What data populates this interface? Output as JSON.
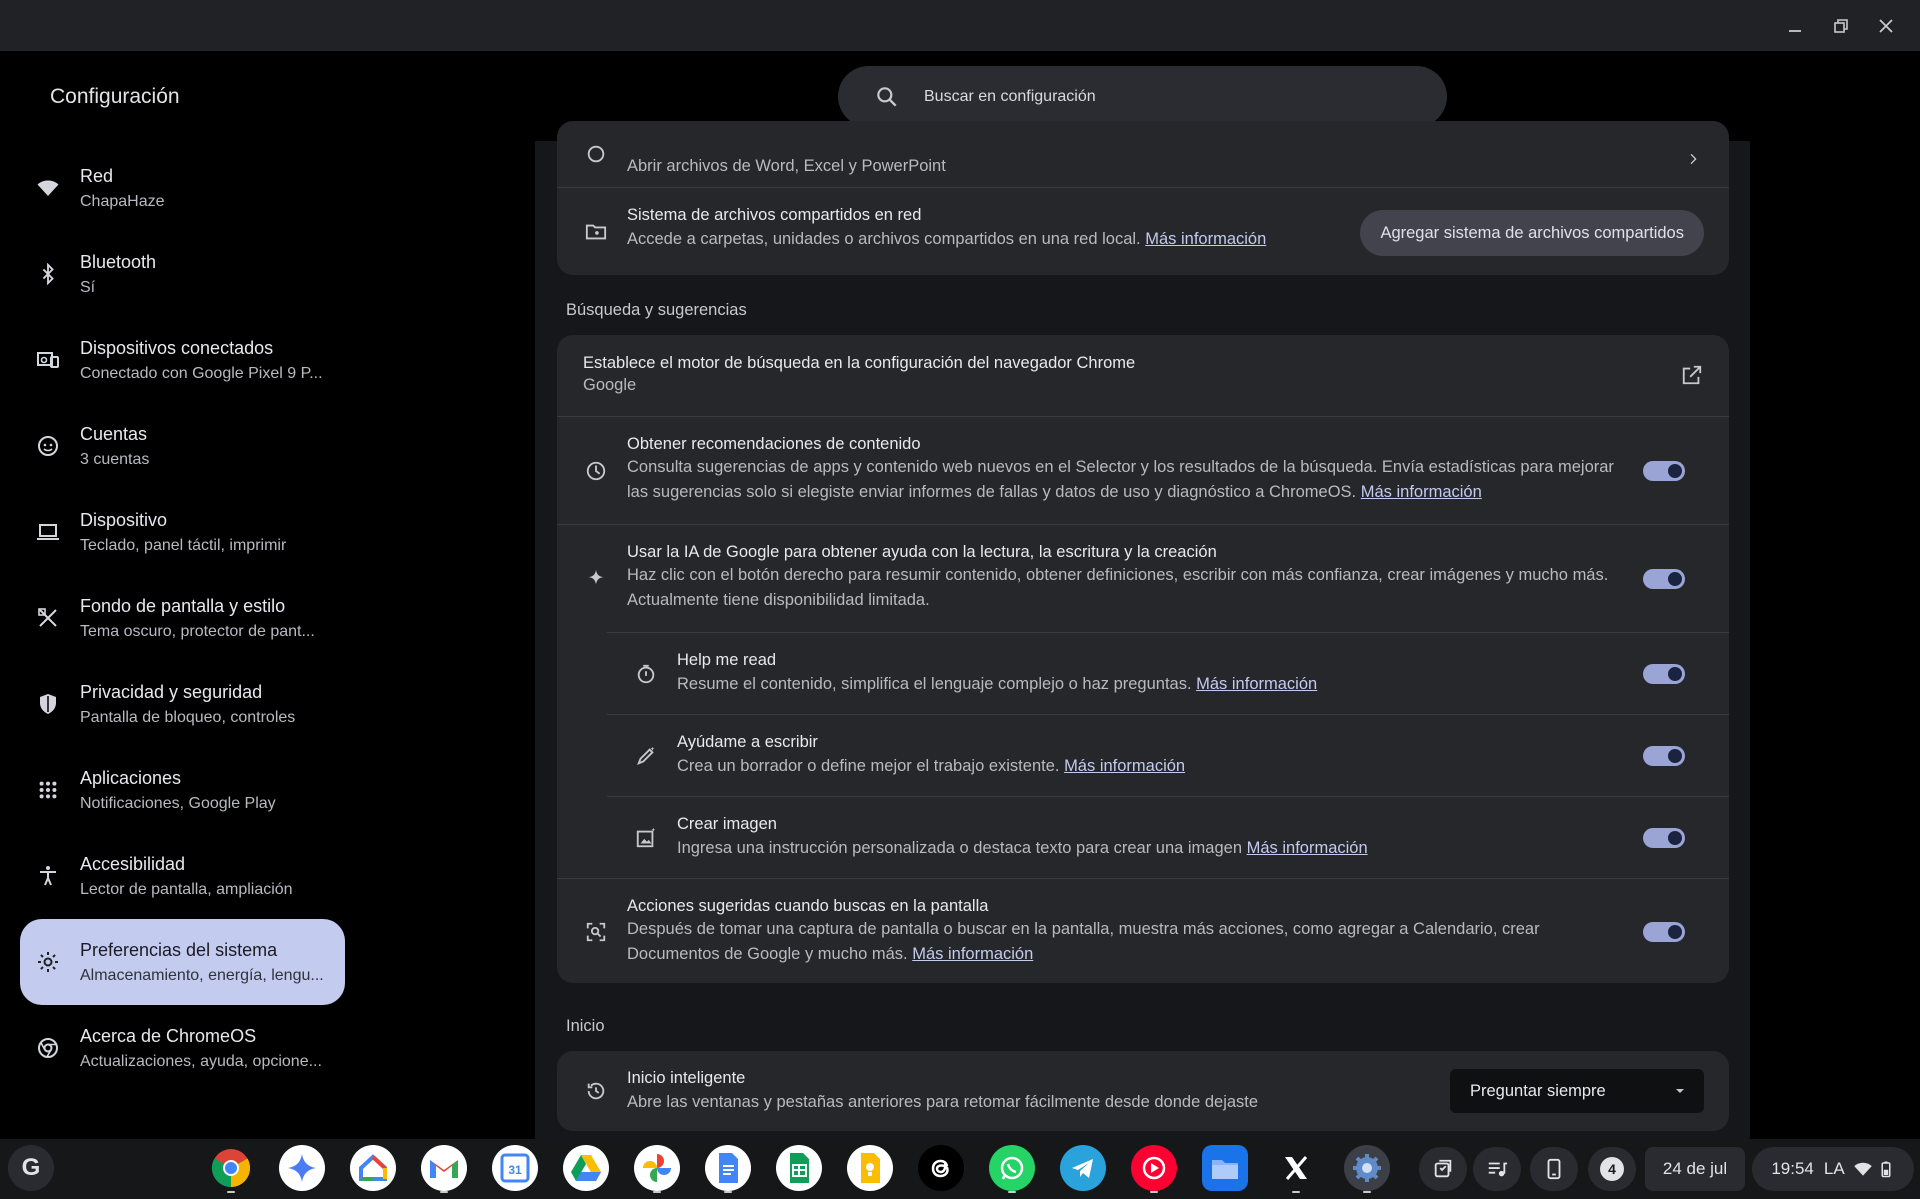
{
  "window": {
    "minimize": "minimize-icon",
    "restore": "restore-icon",
    "close": "close-icon"
  },
  "app": {
    "title": "Configuración"
  },
  "search": {
    "placeholder": "Buscar en configuración"
  },
  "sidebar": {
    "items": [
      {
        "title": "Red",
        "sub": "ChapaHaze",
        "icon": "wifi-icon"
      },
      {
        "title": "Bluetooth",
        "sub": "Sí",
        "icon": "bluetooth-icon"
      },
      {
        "title": "Dispositivos conectados",
        "sub": "Conectado con Google Pixel 9 P...",
        "icon": "devices-icon"
      },
      {
        "title": "Cuentas",
        "sub": "3 cuentas",
        "icon": "account-icon"
      },
      {
        "title": "Dispositivo",
        "sub": "Teclado, panel táctil, imprimir",
        "icon": "laptop-icon"
      },
      {
        "title": "Fondo de pantalla y estilo",
        "sub": "Tema oscuro, protector de pant...",
        "icon": "palette-icon"
      },
      {
        "title": "Privacidad y seguridad",
        "sub": "Pantalla de bloqueo, controles",
        "icon": "shield-icon"
      },
      {
        "title": "Aplicaciones",
        "sub": "Notificaciones, Google Play",
        "icon": "apps-grid-icon"
      },
      {
        "title": "Accesibilidad",
        "sub": "Lector de pantalla, ampliación",
        "icon": "accessibility-icon"
      },
      {
        "title": "Preferencias del sistema",
        "sub": "Almacenamiento, energía, lengu...",
        "icon": "gear-icon",
        "active": true
      },
      {
        "title": "Acerca de ChromeOS",
        "sub": "Actualizaciones, ayuda, opcione...",
        "icon": "chrome-icon"
      }
    ]
  },
  "main": {
    "files_card": {
      "office_desc": "Abrir archivos de Word, Excel y PowerPoint",
      "smb_title": "Sistema de archivos compartidos en red",
      "smb_desc": "Accede a carpetas, unidades o archivos compartidos en una red local.",
      "smb_link": "Más información",
      "smb_button": "Agregar sistema de archivos compartidos"
    },
    "search_section": {
      "heading": "Búsqueda y sugerencias",
      "engine_title": "Establece el motor de búsqueda en la configuración del navegador Chrome",
      "engine_value": "Google",
      "rec_title": "Obtener recomendaciones de contenido",
      "rec_desc_1": "Consulta sugerencias de apps y contenido web nuevos en el Selector y los resultados de la búsqueda. Envía estadísticas para mejorar",
      "rec_desc_2": "las sugerencias solo si elegiste enviar informes de fallas y datos de uso y diagnóstico a ChromeOS.",
      "rec_link": "Más información",
      "ai_title": "Usar la IA de Google para obtener ayuda con la lectura, la escritura y la creación",
      "ai_desc_1": "Haz clic con el botón derecho para resumir contenido, obtener definiciones, escribir con más confianza, crear imágenes y mucho más.",
      "ai_desc_2": "Actualmente tiene disponibilidad limitada.",
      "read_title": "Help me read",
      "read_desc": "Resume el contenido, simplifica el lenguaje complejo o haz preguntas.",
      "read_link": "Más información",
      "write_title": "Ayúdame a escribir",
      "write_desc": "Crea un borrador o define mejor el trabajo existente.",
      "write_link": "Más información",
      "image_title": "Crear imagen",
      "image_desc": "Ingresa una instrucción personalizada o destaca texto para crear una imagen",
      "image_link": "Más información",
      "actions_title": "Acciones sugeridas cuando buscas en la pantalla",
      "actions_desc_1": "Después de tomar una captura de pantalla o buscar en la pantalla, muestra más acciones, como agregar a Calendario, crear",
      "actions_desc_2": "Documentos de Google y mucho más.",
      "actions_link": "Más información"
    },
    "startup_section": {
      "heading": "Inicio",
      "smart_title": "Inicio inteligente",
      "smart_desc": "Abre las ventanas y pestañas anteriores para retomar fácilmente desde donde dejaste",
      "smart_value": "Preguntar siempre"
    }
  },
  "shelf": {
    "launcher": "G",
    "apps": [
      "chrome-icon",
      "gemini-icon",
      "google-home-icon",
      "gmail-icon",
      "calendar-icon",
      "drive-icon",
      "photos-icon",
      "docs-icon",
      "sheets-icon",
      "keep-icon",
      "threads-icon",
      "whatsapp-icon",
      "telegram-icon",
      "youtube-music-icon",
      "files-icon",
      "x-icon",
      "settings-icon"
    ],
    "calendar_day": "31",
    "notifications": "4",
    "date": "24 de jul",
    "time": "19:54",
    "locale": "LA"
  },
  "colors": {
    "accent": "#c3cbef",
    "toggle_on": "#9aa5d6",
    "card": "#26272b"
  }
}
